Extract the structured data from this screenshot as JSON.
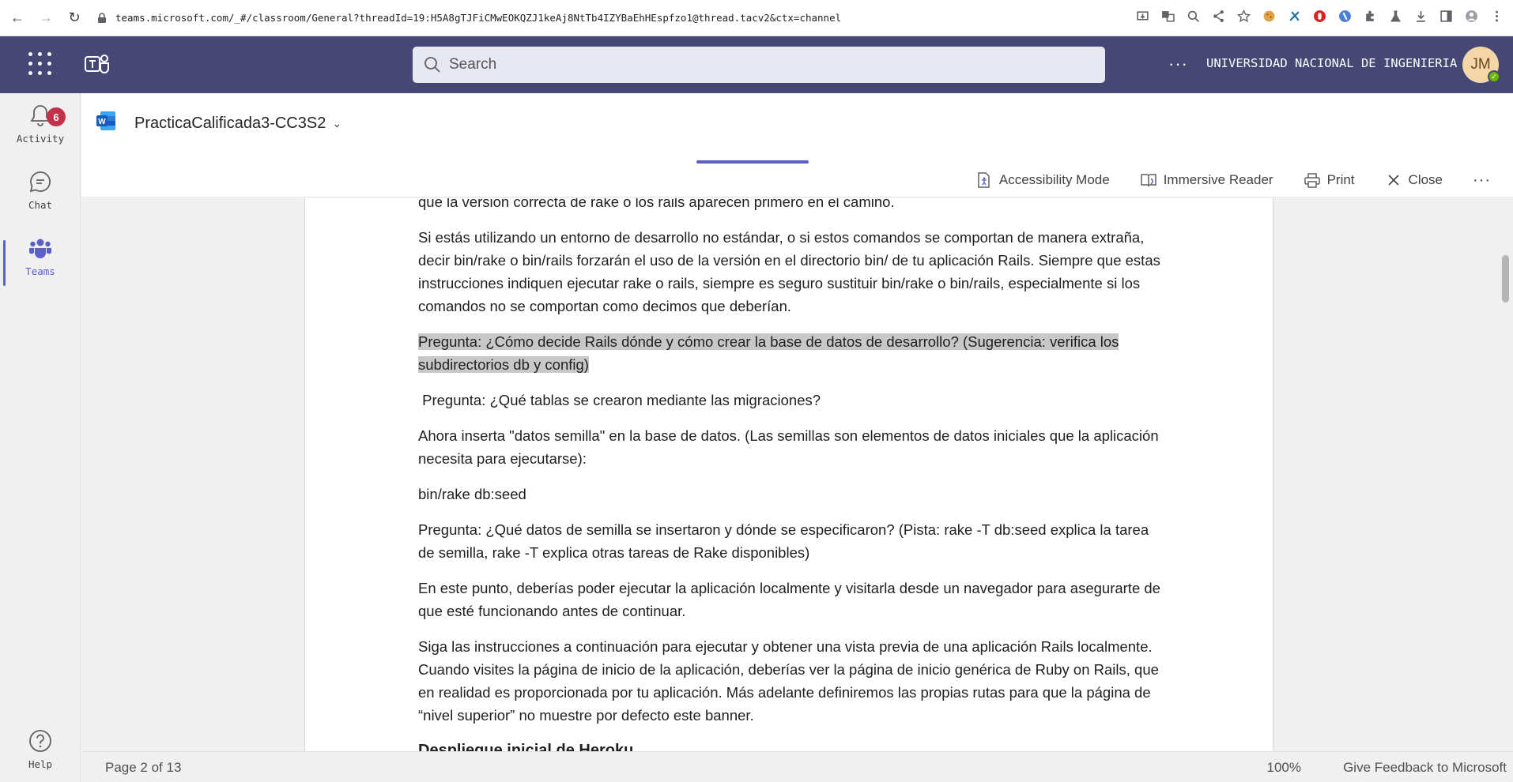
{
  "browser": {
    "url": "teams.microsoft.com/_#/classroom/General?threadId=19:H5A8gTJFiCMwEOKQZJ1keAj8NtTb4IZYBaEhHEspfzo1@thread.tacv2&ctx=channel"
  },
  "header": {
    "search_placeholder": "Search",
    "more": "···",
    "org_name": "UNIVERSIDAD NACIONAL DE INGENIERIA",
    "avatar_initials": "JM"
  },
  "rail": {
    "items": [
      {
        "label": "Activity",
        "badge": "6",
        "icon": "bell-icon"
      },
      {
        "label": "Chat",
        "icon": "chat-icon"
      },
      {
        "label": "Teams",
        "icon": "teams-icon"
      },
      {
        "label": "Help",
        "icon": "help-icon"
      }
    ]
  },
  "document": {
    "title": "PracticaCalificada3-CC3S2",
    "actions": {
      "accessibility": "Accessibility Mode",
      "immersive": "Immersive Reader",
      "print": "Print",
      "close": "Close",
      "more": "···"
    },
    "paragraphs": [
      "que la versión correcta de rake o los rails aparecen primero en el camino.",
      "Si estás utilizando un entorno de desarrollo no estándar, o si estos comandos se comportan de manera extraña, decir bin/rake o bin/rails forzarán el uso de la versión en el directorio bin/ de tu aplicación Rails. Siempre que estas instrucciones indiquen ejecutar rake o rails, siempre es seguro sustituir bin/rake o bin/rails, especialmente si los comandos no se comportan como decimos que deberían.",
      "Pregunta: ¿Cómo decide Rails dónde y cómo crear la base de datos de desarrollo? (Sugerencia: verifica los subdirectorios db y config)",
      " Pregunta: ¿Qué tablas se crearon mediante las migraciones?",
      "Ahora inserta \"datos semilla\" en la base de datos. (Las semillas son elementos de datos iniciales que la aplicación necesita para ejecutarse):",
      "bin/rake db:seed",
      "Pregunta: ¿Qué datos de semilla se insertaron y dónde se especificaron? (Pista: rake -T db:seed explica la tarea de semilla, rake -T explica otras tareas de Rake disponibles)",
      "En este punto, deberías poder ejecutar la aplicación localmente y visitarla desde un navegador para asegurarte de que esté funcionando antes de continuar.",
      "Siga las instrucciones a continuación para ejecutar y obtener una vista previa de una aplicación Rails localmente. Cuando visites la página de inicio de la aplicación, deberías ver la página de inicio genérica de Ruby on Rails, que en realidad es proporcionada por tu aplicación. Más adelante definiremos las propias rutas para que la página de “nivel superior” no muestre por defecto este banner.",
      "Despliegue inicial de Heroku"
    ]
  },
  "status": {
    "page": "Page 2 of 13",
    "zoom": "100%",
    "feedback": "Give Feedback to Microsoft"
  },
  "colors": {
    "teams_header": "#464775",
    "accent": "#5b5fc7",
    "badge": "#c4314b",
    "highlight": "#c8c8c8"
  }
}
